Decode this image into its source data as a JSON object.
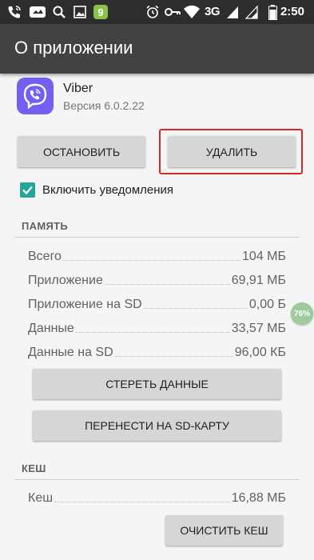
{
  "status_bar": {
    "network": "3G",
    "time": "2:50",
    "icons": [
      "phone-wifi-icon",
      "viber-notification-icon",
      "notification-icon",
      "search-icon",
      "image-icon",
      "app-9-icon",
      "alarm-icon",
      "key-icon",
      "wifi-icon",
      "signal-3g-icon",
      "signal-icon",
      "battery-icon"
    ]
  },
  "app_bar": {
    "title": "О приложении"
  },
  "app": {
    "name": "Viber",
    "version": "Версия 6.0.2.22",
    "icon": "viber-logo-icon",
    "brand_color": "#7360f2"
  },
  "actions": {
    "stop_label": "ОСТАНОВИТЬ",
    "uninstall_label": "УДАЛИТЬ"
  },
  "notifications": {
    "label": "Включить уведомления",
    "checked": true,
    "color": "#26a69a"
  },
  "memory": {
    "header": "ПАМЯТЬ",
    "rows": [
      {
        "label": "Всего",
        "value": "104 МБ"
      },
      {
        "label": "Приложение",
        "value": "69,91 МБ"
      },
      {
        "label": "Приложение на SD",
        "value": "0,00 Б"
      },
      {
        "label": "Данные",
        "value": "33,57 МБ"
      },
      {
        "label": "Данные на SD",
        "value": "96,00 КБ"
      }
    ],
    "clear_data_label": "СТЕРЕТЬ ДАННЫЕ",
    "move_sd_label": "ПЕРЕНЕСТИ НА SD-КАРТУ"
  },
  "cache": {
    "header": "КЕШ",
    "rows": [
      {
        "label": "Кеш",
        "value": "16,88 МБ"
      }
    ],
    "clear_cache_label": "ОЧИСТИТЬ КЕШ"
  },
  "overlay_badge": {
    "text": "76%"
  }
}
